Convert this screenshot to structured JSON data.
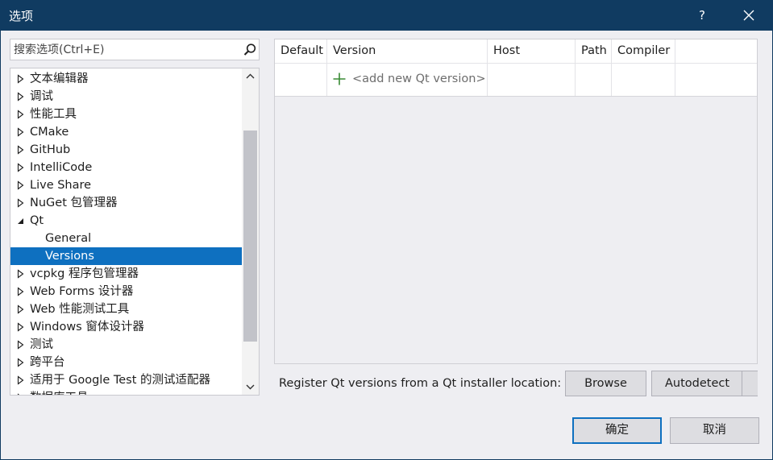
{
  "window": {
    "title": "选项",
    "help_label": "?"
  },
  "search": {
    "placeholder": "搜索选项(Ctrl+E)",
    "value": ""
  },
  "tree": {
    "items": [
      {
        "label": "文本编辑器",
        "state": "collapsed",
        "child": false,
        "selected": false
      },
      {
        "label": "调试",
        "state": "collapsed",
        "child": false,
        "selected": false
      },
      {
        "label": "性能工具",
        "state": "collapsed",
        "child": false,
        "selected": false
      },
      {
        "label": "CMake",
        "state": "collapsed",
        "child": false,
        "selected": false
      },
      {
        "label": "GitHub",
        "state": "collapsed",
        "child": false,
        "selected": false
      },
      {
        "label": "IntelliCode",
        "state": "collapsed",
        "child": false,
        "selected": false
      },
      {
        "label": "Live Share",
        "state": "collapsed",
        "child": false,
        "selected": false
      },
      {
        "label": "NuGet 包管理器",
        "state": "collapsed",
        "child": false,
        "selected": false
      },
      {
        "label": "Qt",
        "state": "expanded",
        "child": false,
        "selected": false
      },
      {
        "label": "General",
        "state": "none",
        "child": true,
        "selected": false
      },
      {
        "label": "Versions",
        "state": "none",
        "child": true,
        "selected": true
      },
      {
        "label": "vcpkg 程序包管理器",
        "state": "collapsed",
        "child": false,
        "selected": false
      },
      {
        "label": "Web Forms 设计器",
        "state": "collapsed",
        "child": false,
        "selected": false
      },
      {
        "label": "Web 性能测试工具",
        "state": "collapsed",
        "child": false,
        "selected": false
      },
      {
        "label": "Windows 窗体设计器",
        "state": "collapsed",
        "child": false,
        "selected": false
      },
      {
        "label": "测试",
        "state": "collapsed",
        "child": false,
        "selected": false
      },
      {
        "label": "跨平台",
        "state": "collapsed",
        "child": false,
        "selected": false
      },
      {
        "label": "适用于 Google Test 的测试适配器",
        "state": "collapsed",
        "child": false,
        "selected": false
      },
      {
        "label": "数据库工具",
        "state": "collapsed",
        "child": false,
        "selected": false
      }
    ]
  },
  "versions_grid": {
    "columns": [
      "Default",
      "Version",
      "Host",
      "Path",
      "Compiler"
    ],
    "add_row_text": "<add new Qt version>"
  },
  "register": {
    "label": "Register Qt versions from a Qt installer location:",
    "browse_label": "Browse",
    "autodetect_label": "Autodetect"
  },
  "dialog_buttons": {
    "ok_label": "确定",
    "cancel_label": "取消"
  },
  "colors": {
    "titlebar": "#103b61",
    "selection": "#0e70c0",
    "add_icon": "#388a34"
  }
}
